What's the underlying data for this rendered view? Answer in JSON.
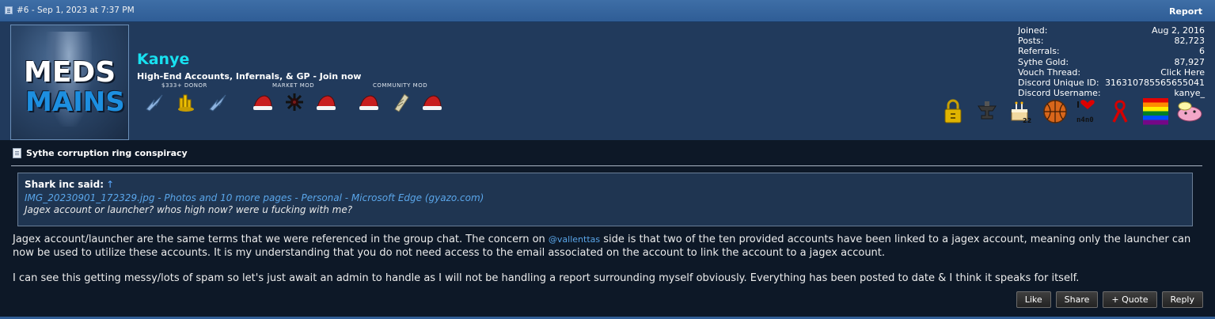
{
  "header": {
    "post_meta": "#6 - Sep 1, 2023 at 7:37 PM",
    "report": "Report"
  },
  "user": {
    "avatar_text_line1": "MEDS",
    "avatar_text_line2": "MAINS",
    "name": "Kanye",
    "title": "High-End Accounts, Infernals, & GP - Join now",
    "rank_labels": [
      "$333+ DONOR",
      "MARKET MOD",
      "COMMUNITY MOD"
    ],
    "rank_icons": [
      "mithril-dragon-icon",
      "gold-coins-icon",
      "mithril-dragon-icon",
      "santa-hat-icon",
      "black-party-hat-icon",
      "santa-hat-icon",
      "santa-hat-icon",
      "scroll-icon",
      "santa-hat-icon"
    ],
    "stats": [
      {
        "label": "Joined:",
        "value": "Aug 2, 2016"
      },
      {
        "label": "Posts:",
        "value": "82,723"
      },
      {
        "label": "Referrals:",
        "value": "6"
      },
      {
        "label": "Sythe Gold:",
        "value": "87,927"
      },
      {
        "label": "Vouch Thread:",
        "value": "Click Here"
      },
      {
        "label": "Discord Unique ID:",
        "value": "316310785565655041"
      },
      {
        "label": "Discord Username:",
        "value": "kanye_"
      }
    ],
    "awards": [
      "padlock-icon",
      "anvil-icon",
      "cake-icon",
      "basketball-icon",
      "i-love-n4n0-icon",
      "ribbon-icon",
      "rainbow-flag-icon",
      "pink-creature-icon"
    ],
    "award_texts": {
      "cake_number": "22",
      "heart_top": "I",
      "heart_bottom": "n4n0"
    }
  },
  "post": {
    "thread_title": "Sythe corruption ring conspiracy",
    "quote": {
      "author": "Shark inc said:",
      "arrow": "↑",
      "link_text": "IMG_20230901_172329.jpg - Photos and 10 more pages - Personal - Microsoft Edge (gyazo.com)",
      "line": "Jagex account or launcher? whos high now? were u fucking with me?"
    },
    "paragraph1_before": "Jagex account/launcher are the same terms that we were referenced in the group chat. The concern on ",
    "mention": "@vallenttas",
    "paragraph1_after": " side is that two of the ten provided accounts have been linked to a jagex account, meaning only the launcher can now be used to utilize these accounts. It is my understanding that you do not need access to the email associated on the account to link the account to a jagex account.",
    "paragraph2": "I can see this getting messy/lots of spam so let's just await an admin to handle as I will not be handling a report surrounding myself obviously. Everything has been posted to date & I think it speaks for itself."
  },
  "actions": {
    "like": "Like",
    "share": "Share",
    "quote": "+ Quote",
    "reply": "Reply"
  },
  "colors": {
    "header_bar": "#2f5d96",
    "userbar_bg": "#213a5c",
    "content_bg": "#0d1827",
    "username": "#18e1f0",
    "link": "#5aa6ea"
  }
}
